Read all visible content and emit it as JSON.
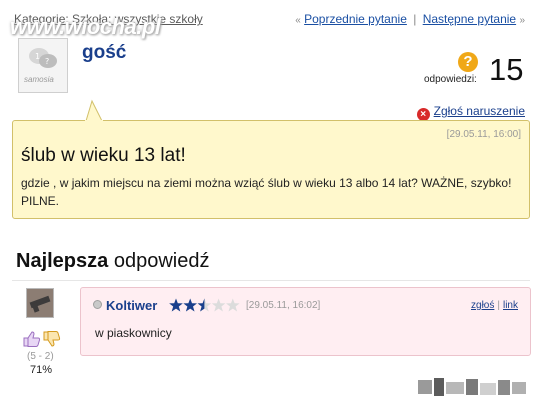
{
  "breadcrumb": "Kategorie: Szkoła: wszystkie szkoły",
  "watermark": "www.wiocha.pl",
  "nav": {
    "prev_label": "Poprzednie pytanie",
    "next_label": "Następne pytanie",
    "prev_arrow": "«",
    "next_arrow": "»",
    "sep": "|"
  },
  "question": {
    "asker": "gość",
    "avatar_brand": "samosia",
    "answers_label": "odpowiedzi:",
    "answers_count": "15",
    "report_label": "Zgłoś naruszenie",
    "date": "[29.05.11, 16:00]",
    "title": "ślub w wieku 13 lat!",
    "body": "gdzie , w jakim miejscu na ziemi można wziąć ślub w wieku 13 albo 14 lat? WAŻNE, szybko! PILNE."
  },
  "best_answer": {
    "heading_bold": "Najlepsza",
    "heading_rest": "odpowiedź",
    "author": "Koltiwer",
    "rating": 2.5,
    "rating_max": 5,
    "date": "[29.05.11, 16:02]",
    "report_label": "zgłoś",
    "link_label": "link",
    "link_sep": "|",
    "text": "w piaskownicy",
    "votes": "(5 - 2)",
    "percent": "71%"
  },
  "colors": {
    "link": "#1a3f8c",
    "question_bg": "#fff8cc",
    "answer_bg": "#ffeef2",
    "star": "#1a3f8c",
    "badge": "#f0a818",
    "report_icon": "#d82a2a"
  }
}
